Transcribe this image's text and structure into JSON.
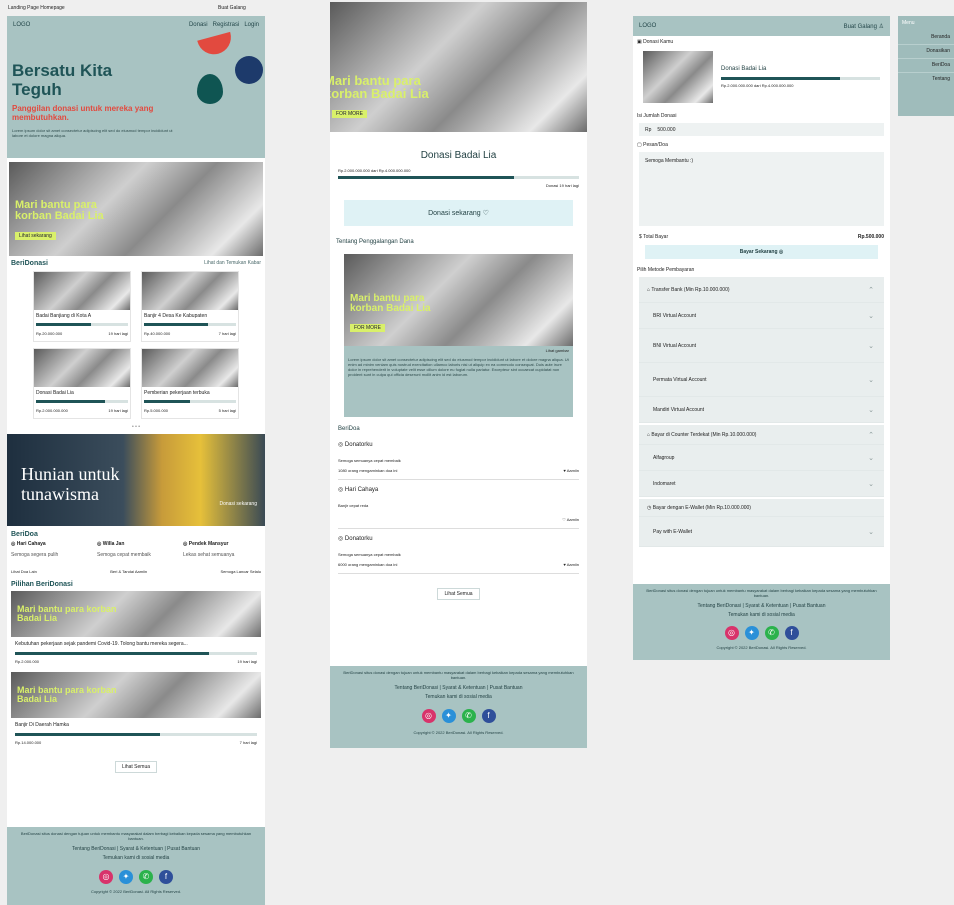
{
  "page_label": "Landing Page Homepage",
  "top_right_label": "Buat Galang",
  "c1": {
    "logo": "LOGO",
    "nav": [
      "Donasi",
      "Registrasi",
      "Login"
    ],
    "hero_title": "Bersatu Kita Teguh",
    "hero_sub": "Panggilan donasi untuk mereka yang membutuhkan.",
    "hero_desc": "Lorem ipsum dolor sit amet consectetur adipiscing elit sed do eiusmod tempor incididunt ut labore et dolore magna aliqua.",
    "banner_caption": "Mari bantu para korban Badai Lia",
    "banner_btn": "Lihat sekarang",
    "section_title": "BeriDonasi",
    "see_all": "Lihat dan Temukan Kabar",
    "cards": [
      {
        "title": "Badai Banjiang di Kota A",
        "amount": "Rp.20.000.000",
        "days": "19 hari lagi",
        "progress": 0.6
      },
      {
        "title": "Banjir 4 Desa Ke Kabupaten",
        "amount": "Rp.40.000.000",
        "days": "7 hari lagi",
        "progress": 0.7
      },
      {
        "title": "Donasi Badai Lia",
        "amount": "Rp.2.000.000.000",
        "days": "19 hari lagi",
        "progress": 0.75
      },
      {
        "title": "Pemberian pekerjaan terbuka",
        "amount": "Rp.5.000.000",
        "days": "5 hari lagi",
        "progress": 0.5
      }
    ],
    "dots": "• • •",
    "hunian": "Hunian untuk tunawisma",
    "hunian_btn": "Donasi sekarang",
    "bericita_title": "BeriDoa",
    "doa": [
      {
        "name": "Hari Cahaya",
        "text": "Semoga segera pulih"
      },
      {
        "name": "Willa Jan",
        "text": "Semoga cepat membaik"
      },
      {
        "name": "Pendek Mansyur",
        "text": "Lekas sehat semuanya"
      }
    ],
    "doa_links": [
      "Lihat Doa Lain",
      "Beri & Tandai Aamiin",
      "Semoga Lancar Selalu"
    ],
    "pilihan_title": "Pilihan BeriDonasi",
    "pilihan": [
      {
        "caption": "Mari bantu para korban Badai Lia",
        "title": "Kebutuhan pekerjaan sejak pandemi Covid-19. Tolong bantu mereka segera...",
        "amount": "Rp.2.000.000",
        "days": "19 hari lagi",
        "progress": 0.8
      },
      {
        "caption": "Mari bantu para korban Badai Lia",
        "title": "Banjir Di Daerah Hamka",
        "amount": "Rp.14.000.000",
        "days": "7 hari lagi",
        "progress": 0.6
      }
    ],
    "more_btn": "Lihat Semua"
  },
  "c2": {
    "caption": "Mari bantu para korban Badai Lia",
    "pill": "FOR MORE",
    "title": "Donasi Badai Lia",
    "raised": "Rp.2.000.000.000 dari Rp.4.000.000.000",
    "remaining": "Donasi 19 hari lagi",
    "donate_btn": "Donasi sekarang",
    "tentang": "Tentang Penggalangan Dana",
    "photo_note": "Lihat gambar",
    "lorem": "Lorem ipsum dolor sit amet consectetur adipiscing elit sed do eiusmod tempor incididunt ut labore et dolore magna aliqua. Ut enim ad minim veniam quis nostrud exercitation ullamco laboris nisi ut aliquip ex ea commodo consequat. Duis aute irure dolor in reprehenderit in voluptate velit esse cillum dolore eu fugiat nulla pariatur. Excepteur sint occaecat cupidatat non proident sunt in culpa qui officia deserunt mollit anim id est laborum.",
    "beridoa": "BeriDoa",
    "prayers": [
      {
        "name": "Donatorku",
        "text": "Semoga semuanya cepat membaik",
        "count": "1080 orang mengaminkan doa ini",
        "action": "Aamiin"
      },
      {
        "name": "Hari Cahaya",
        "text": "Banjir cepat reda",
        "count": "",
        "action": "Aamiin"
      },
      {
        "name": "Donatorku",
        "text": "Semoga semuanya cepat membaik",
        "count": "6000 orang mengaminkan doa ini",
        "action": "Aamiin"
      }
    ],
    "more_btn": "Lihat Semua"
  },
  "c3": {
    "logo": "LOGO",
    "nav_right": "Buat Galang",
    "donasi_kamu": "Donasi Kamu",
    "card_title": "Donasi Badai Lia",
    "card_raised": "Rp.2.000.000.000 dari Rp.4.000.000.000",
    "jumlah_label": "Isi Jumlah Donasi",
    "rp": "Rp",
    "jumlah_val": "500.000",
    "pesan_label": "Pesan/Doa",
    "pesan_val": "Semoga Membantu :)",
    "total_label": "Total Bayar",
    "total_val": "Rp.500.000",
    "bayar_btn": "Bayar Sekarang",
    "pilih_label": "Pilih Metode Pembayaran",
    "groups": [
      {
        "title": "Transfer Bank (Min Rp.10.000.000)",
        "items": [
          "BRI Virtual Account",
          "BNI Virtual Account",
          "Permata Virtual Account",
          "Mandiri Virtual Account"
        ]
      },
      {
        "title": "Bayar di Counter Terdekat (Min Rp.10.000.000)",
        "items": [
          "Alfagroup",
          "Indomaret"
        ]
      },
      {
        "title": "Bayar dengan E-Wallet (Min Rp.10.000.000)",
        "items": [
          "Pay with E-Wallet"
        ]
      }
    ]
  },
  "footer": {
    "desc": "BeriDonasi situs donasi dengan tujuan untuk membantu masyarakat dalam berbagi kebaikan kepada sesama yang membutuhkan bantuan.",
    "links": "Tentang BeriDonasi | Syarat & Ketentuan | Pusat Bantuan",
    "follow": "Temukan kami di sosial media",
    "copy": "Copyright © 2022 BeriDonasi. All Rights Reserved."
  },
  "side": [
    "Menu",
    "Beranda",
    "Donasikan",
    "BeriDoa",
    "Tentang"
  ],
  "colors": {
    "teal": "#a8c3c2",
    "dark_teal": "#1f5457",
    "accent_red": "#e24a3f",
    "accent_lime": "#d9f06a",
    "instagram": "#d8336b",
    "twitter": "#2a90d8",
    "whatsapp": "#2bb24c",
    "facebook": "#2f4f9a"
  }
}
